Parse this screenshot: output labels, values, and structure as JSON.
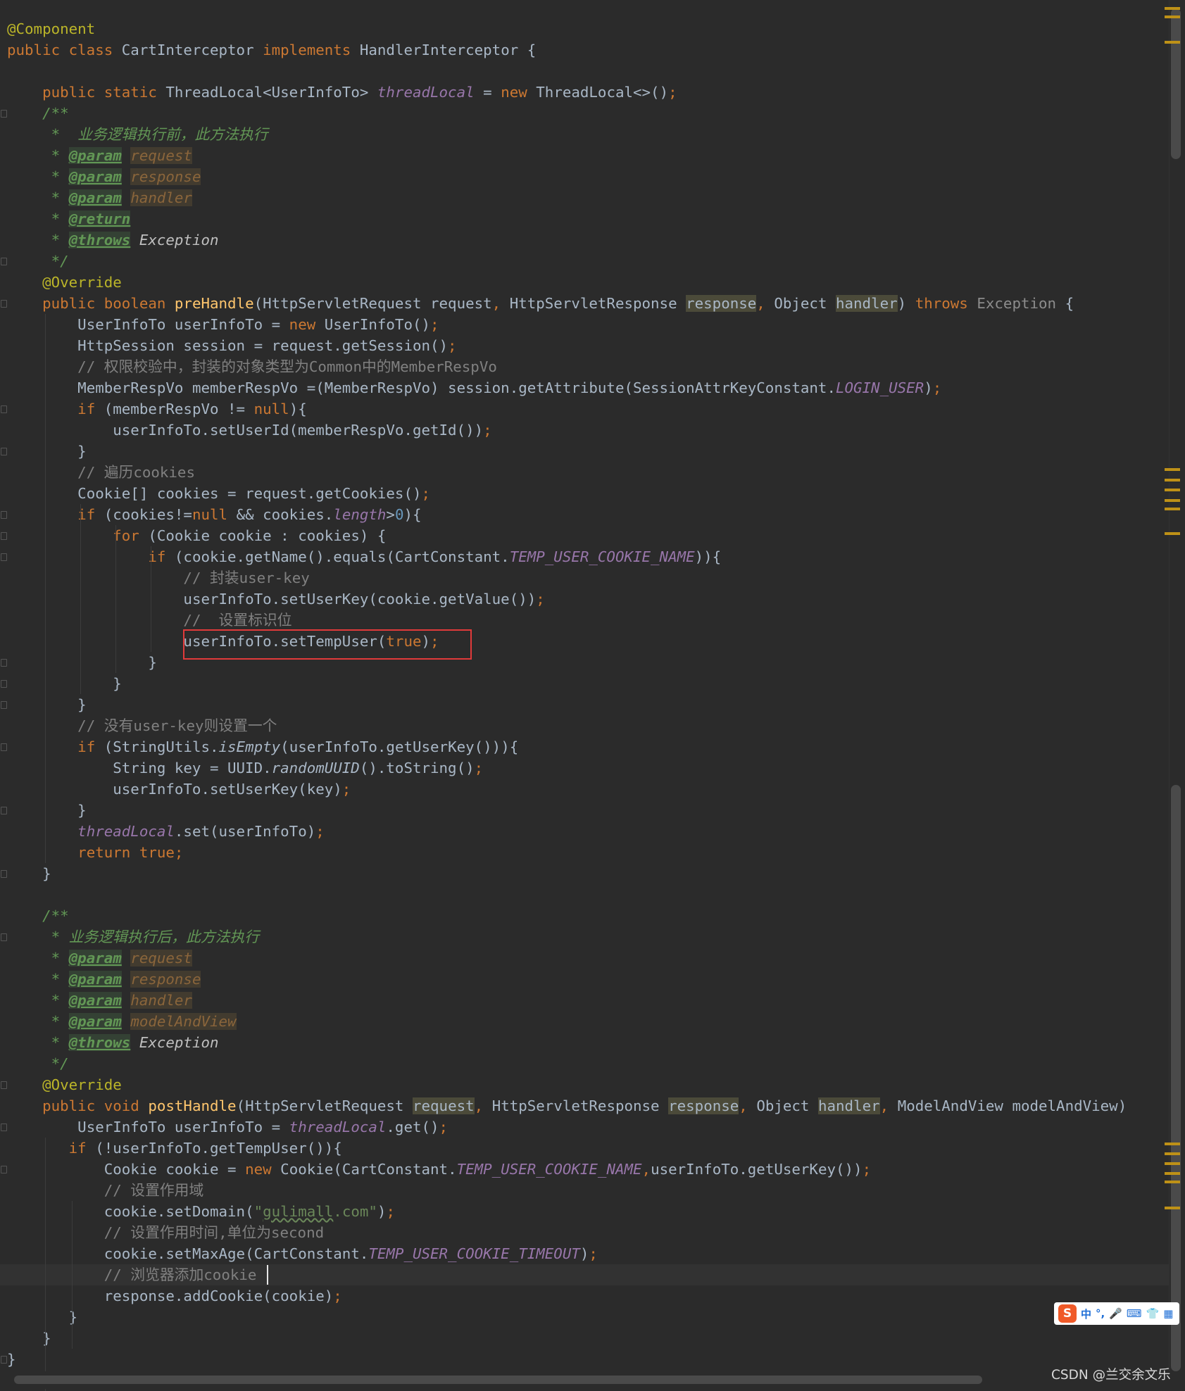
{
  "editor": {
    "code_lines": [
      {
        "indent": 0,
        "tokens": [
          {
            "t": "@Component",
            "c": "ann"
          }
        ]
      },
      {
        "indent": 0,
        "tokens": [
          {
            "t": "public class ",
            "c": "kw"
          },
          {
            "t": "CartInterceptor ",
            "c": "text"
          },
          {
            "t": "implements ",
            "c": "kw"
          },
          {
            "t": "HandlerInterceptor {",
            "c": "text"
          }
        ]
      },
      {
        "indent": 0,
        "tokens": []
      },
      {
        "indent": 4,
        "tokens": [
          {
            "t": "public static ",
            "c": "kw"
          },
          {
            "t": "ThreadLocal<UserInfoTo> ",
            "c": "text"
          },
          {
            "t": "threadLocal",
            "c": "field"
          },
          {
            "t": " = ",
            "c": "text"
          },
          {
            "t": "new ",
            "c": "kw"
          },
          {
            "t": "ThreadLocal<>()",
            "c": "text"
          },
          {
            "t": ";",
            "c": "semi"
          }
        ]
      },
      {
        "indent": 4,
        "tokens": [
          {
            "t": "/**",
            "c": "doc"
          }
        ]
      },
      {
        "indent": 4,
        "tokens": [
          {
            "t": " *  业务逻辑执行前，此方法执行",
            "c": "doc"
          }
        ]
      },
      {
        "indent": 4,
        "tokens": [
          {
            "t": " * ",
            "c": "doc"
          },
          {
            "t": "@param",
            "c": "tag"
          },
          {
            "t": " ",
            "c": "doc"
          },
          {
            "t": "request",
            "c": "tagval"
          }
        ]
      },
      {
        "indent": 4,
        "tokens": [
          {
            "t": " * ",
            "c": "doc"
          },
          {
            "t": "@param",
            "c": "tag"
          },
          {
            "t": " ",
            "c": "doc"
          },
          {
            "t": "response",
            "c": "tagval"
          }
        ]
      },
      {
        "indent": 4,
        "tokens": [
          {
            "t": " * ",
            "c": "doc"
          },
          {
            "t": "@param",
            "c": "tag"
          },
          {
            "t": " ",
            "c": "doc"
          },
          {
            "t": "handler",
            "c": "tagval"
          }
        ]
      },
      {
        "indent": 4,
        "tokens": [
          {
            "t": " * ",
            "c": "doc"
          },
          {
            "t": "@return",
            "c": "tag"
          }
        ]
      },
      {
        "indent": 4,
        "tokens": [
          {
            "t": " * ",
            "c": "doc"
          },
          {
            "t": "@throws",
            "c": "tag"
          },
          {
            "t": " Exception",
            "c": "docplain"
          }
        ]
      },
      {
        "indent": 4,
        "tokens": [
          {
            "t": " */",
            "c": "doc"
          }
        ]
      },
      {
        "indent": 4,
        "tokens": [
          {
            "t": "@Override",
            "c": "ann"
          }
        ]
      },
      {
        "indent": 4,
        "tokens": [
          {
            "t": "public boolean ",
            "c": "kw"
          },
          {
            "t": "preHandle",
            "c": "method"
          },
          {
            "t": "(HttpServletRequest request",
            "c": "text"
          },
          {
            "t": ", ",
            "c": "semi"
          },
          {
            "t": "HttpServletResponse ",
            "c": "text"
          },
          {
            "t": "response",
            "c": "hl"
          },
          {
            "t": ", ",
            "c": "semi"
          },
          {
            "t": "Object ",
            "c": "text"
          },
          {
            "t": "handler",
            "c": "hl"
          },
          {
            "t": ") ",
            "c": "text"
          },
          {
            "t": "throws ",
            "c": "kw"
          },
          {
            "t": "Exception",
            "c": "unused"
          },
          {
            "t": " {",
            "c": "text"
          }
        ]
      },
      {
        "indent": 8,
        "tokens": [
          {
            "t": "UserInfoTo userInfoTo = ",
            "c": "text"
          },
          {
            "t": "new ",
            "c": "kw"
          },
          {
            "t": "UserInfoTo()",
            "c": "text"
          },
          {
            "t": ";",
            "c": "semi"
          }
        ]
      },
      {
        "indent": 8,
        "tokens": [
          {
            "t": "HttpSession session = request.getSession()",
            "c": "text"
          },
          {
            "t": ";",
            "c": "semi"
          }
        ]
      },
      {
        "indent": 8,
        "tokens": [
          {
            "t": "// 权限校验中，封装的对象类型为Common中的MemberRespVo",
            "c": "comment"
          }
        ]
      },
      {
        "indent": 8,
        "tokens": [
          {
            "t": "MemberRespVo memberRespVo =(MemberRespVo) session.getAttribute(SessionAttrKeyConstant.",
            "c": "text"
          },
          {
            "t": "LOGIN_USER",
            "c": "field"
          },
          {
            "t": ")",
            "c": "text"
          },
          {
            "t": ";",
            "c": "semi"
          }
        ]
      },
      {
        "indent": 8,
        "tokens": [
          {
            "t": "if ",
            "c": "kw"
          },
          {
            "t": "(memberRespVo != ",
            "c": "text"
          },
          {
            "t": "null",
            "c": "kw"
          },
          {
            "t": "){",
            "c": "text"
          }
        ]
      },
      {
        "indent": 12,
        "tokens": [
          {
            "t": "userInfoTo.setUserId(memberRespVo.getId())",
            "c": "text"
          },
          {
            "t": ";",
            "c": "semi"
          }
        ]
      },
      {
        "indent": 8,
        "tokens": [
          {
            "t": "}",
            "c": "text"
          }
        ]
      },
      {
        "indent": 8,
        "tokens": [
          {
            "t": "// 遍历cookies",
            "c": "comment"
          }
        ]
      },
      {
        "indent": 8,
        "tokens": [
          {
            "t": "Cookie[] cookies = request.getCookies()",
            "c": "text"
          },
          {
            "t": ";",
            "c": "semi"
          }
        ]
      },
      {
        "indent": 8,
        "tokens": [
          {
            "t": "if ",
            "c": "kw"
          },
          {
            "t": "(cookies!=",
            "c": "text"
          },
          {
            "t": "null ",
            "c": "kw"
          },
          {
            "t": "&& cookies.",
            "c": "text"
          },
          {
            "t": "length",
            "c": "field"
          },
          {
            "t": ">",
            "c": "text"
          },
          {
            "t": "0",
            "c": "num"
          },
          {
            "t": "){",
            "c": "text"
          }
        ]
      },
      {
        "indent": 12,
        "tokens": [
          {
            "t": "for ",
            "c": "kw"
          },
          {
            "t": "(Cookie cookie : cookies) {",
            "c": "text"
          }
        ]
      },
      {
        "indent": 16,
        "tokens": [
          {
            "t": "if ",
            "c": "kw"
          },
          {
            "t": "(cookie.getName().equals(CartConstant.",
            "c": "text"
          },
          {
            "t": "TEMP_USER_COOKIE_NAME",
            "c": "field"
          },
          {
            "t": ")){",
            "c": "text"
          }
        ]
      },
      {
        "indent": 20,
        "tokens": [
          {
            "t": "// 封装user-key",
            "c": "comment"
          }
        ]
      },
      {
        "indent": 20,
        "tokens": [
          {
            "t": "userInfoTo.setUserKey(cookie.getValue())",
            "c": "text"
          },
          {
            "t": ";",
            "c": "semi"
          }
        ]
      },
      {
        "indent": 20,
        "tokens": [
          {
            "t": "//  设置标识位",
            "c": "comment"
          }
        ]
      },
      {
        "indent": 20,
        "tokens": [
          {
            "t": "userInfoTo.setTempUser(",
            "c": "text"
          },
          {
            "t": "true",
            "c": "kw"
          },
          {
            "t": ")",
            "c": "text"
          },
          {
            "t": ";",
            "c": "semi"
          }
        ]
      },
      {
        "indent": 16,
        "tokens": [
          {
            "t": "}",
            "c": "text"
          }
        ]
      },
      {
        "indent": 12,
        "tokens": [
          {
            "t": "}",
            "c": "text"
          }
        ]
      },
      {
        "indent": 8,
        "tokens": [
          {
            "t": "}",
            "c": "text"
          }
        ]
      },
      {
        "indent": 8,
        "tokens": [
          {
            "t": "// 没有user-key则设置一个",
            "c": "comment"
          }
        ]
      },
      {
        "indent": 8,
        "tokens": [
          {
            "t": "if ",
            "c": "kw"
          },
          {
            "t": "(StringUtils.",
            "c": "text"
          },
          {
            "t": "isEmpty",
            "c": "smethod"
          },
          {
            "t": "(userInfoTo.getUserKey())){",
            "c": "text"
          }
        ]
      },
      {
        "indent": 12,
        "tokens": [
          {
            "t": "String key = UUID.",
            "c": "text"
          },
          {
            "t": "randomUUID",
            "c": "smethod"
          },
          {
            "t": "().toString()",
            "c": "text"
          },
          {
            "t": ";",
            "c": "semi"
          }
        ]
      },
      {
        "indent": 12,
        "tokens": [
          {
            "t": "userInfoTo.setUserKey(key)",
            "c": "text"
          },
          {
            "t": ";",
            "c": "semi"
          }
        ]
      },
      {
        "indent": 8,
        "tokens": [
          {
            "t": "}",
            "c": "text"
          }
        ]
      },
      {
        "indent": 8,
        "tokens": [
          {
            "t": "threadLocal",
            "c": "field"
          },
          {
            "t": ".set(userInfoTo)",
            "c": "text"
          },
          {
            "t": ";",
            "c": "semi"
          }
        ]
      },
      {
        "indent": 8,
        "tokens": [
          {
            "t": "return true",
            "c": "kw"
          },
          {
            "t": ";",
            "c": "semi"
          }
        ]
      },
      {
        "indent": 4,
        "tokens": [
          {
            "t": "}",
            "c": "text"
          }
        ]
      },
      {
        "indent": 0,
        "tokens": []
      },
      {
        "indent": 4,
        "tokens": [
          {
            "t": "/**",
            "c": "doc"
          }
        ]
      },
      {
        "indent": 4,
        "tokens": [
          {
            "t": " * 业务逻辑执行后，此方法执行",
            "c": "doc"
          }
        ]
      },
      {
        "indent": 4,
        "tokens": [
          {
            "t": " * ",
            "c": "doc"
          },
          {
            "t": "@param",
            "c": "tag"
          },
          {
            "t": " ",
            "c": "doc"
          },
          {
            "t": "request",
            "c": "tagval"
          }
        ]
      },
      {
        "indent": 4,
        "tokens": [
          {
            "t": " * ",
            "c": "doc"
          },
          {
            "t": "@param",
            "c": "tag"
          },
          {
            "t": " ",
            "c": "doc"
          },
          {
            "t": "response",
            "c": "tagval"
          }
        ]
      },
      {
        "indent": 4,
        "tokens": [
          {
            "t": " * ",
            "c": "doc"
          },
          {
            "t": "@param",
            "c": "tag"
          },
          {
            "t": " ",
            "c": "doc"
          },
          {
            "t": "handler",
            "c": "tagval"
          }
        ]
      },
      {
        "indent": 4,
        "tokens": [
          {
            "t": " * ",
            "c": "doc"
          },
          {
            "t": "@param",
            "c": "tag"
          },
          {
            "t": " ",
            "c": "doc"
          },
          {
            "t": "modelAndView",
            "c": "tagval"
          }
        ]
      },
      {
        "indent": 4,
        "tokens": [
          {
            "t": " * ",
            "c": "doc"
          },
          {
            "t": "@throws",
            "c": "tag"
          },
          {
            "t": " Exception",
            "c": "docplain"
          }
        ]
      },
      {
        "indent": 4,
        "tokens": [
          {
            "t": " */",
            "c": "doc"
          }
        ]
      },
      {
        "indent": 4,
        "tokens": [
          {
            "t": "@Override",
            "c": "ann"
          }
        ]
      },
      {
        "indent": 4,
        "tokens": [
          {
            "t": "public void ",
            "c": "kw"
          },
          {
            "t": "postHandle",
            "c": "method"
          },
          {
            "t": "(HttpServletRequest ",
            "c": "text"
          },
          {
            "t": "request",
            "c": "hl"
          },
          {
            "t": ", ",
            "c": "semi"
          },
          {
            "t": "HttpServletResponse ",
            "c": "text"
          },
          {
            "t": "response",
            "c": "hl"
          },
          {
            "t": ", ",
            "c": "semi"
          },
          {
            "t": "Object ",
            "c": "text"
          },
          {
            "t": "handler",
            "c": "hl"
          },
          {
            "t": ", ",
            "c": "semi"
          },
          {
            "t": "ModelAndView modelAndView)",
            "c": "text"
          }
        ]
      },
      {
        "indent": 8,
        "tokens": [
          {
            "t": "UserInfoTo userInfoTo = ",
            "c": "text"
          },
          {
            "t": "threadLocal",
            "c": "field"
          },
          {
            "t": ".get()",
            "c": "text"
          },
          {
            "t": ";",
            "c": "semi"
          }
        ]
      },
      {
        "indent": 7,
        "tokens": [
          {
            "t": "if ",
            "c": "kw"
          },
          {
            "t": "(!userInfoTo.getTempUser()){",
            "c": "text"
          }
        ]
      },
      {
        "indent": 11,
        "tokens": [
          {
            "t": "Cookie cookie = ",
            "c": "text"
          },
          {
            "t": "new ",
            "c": "kw"
          },
          {
            "t": "Cookie(CartConstant.",
            "c": "text"
          },
          {
            "t": "TEMP_USER_COOKIE_NAME",
            "c": "field"
          },
          {
            "t": ",",
            "c": "semi"
          },
          {
            "t": "userInfoTo.getUserKey())",
            "c": "text"
          },
          {
            "t": ";",
            "c": "semi"
          }
        ]
      },
      {
        "indent": 11,
        "tokens": [
          {
            "t": "// 设置作用域",
            "c": "comment"
          }
        ]
      },
      {
        "indent": 11,
        "tokens": [
          {
            "t": "cookie.setDomain(",
            "c": "text"
          },
          {
            "t": "\"",
            "c": "string"
          },
          {
            "t": "gulimall",
            "c": "typo"
          },
          {
            "t": ".com\"",
            "c": "string"
          },
          {
            "t": ")",
            "c": "text"
          },
          {
            "t": ";",
            "c": "semi"
          }
        ]
      },
      {
        "indent": 11,
        "tokens": [
          {
            "t": "// 设置作用时间,单位为second",
            "c": "comment"
          }
        ]
      },
      {
        "indent": 11,
        "tokens": [
          {
            "t": "cookie.setMaxAge(CartConstant.",
            "c": "text"
          },
          {
            "t": "TEMP_USER_COOKIE_TIMEOUT",
            "c": "field"
          },
          {
            "t": ")",
            "c": "text"
          },
          {
            "t": ";",
            "c": "semi"
          }
        ]
      },
      {
        "indent": 11,
        "current": true,
        "tokens": [
          {
            "t": "// 浏览器添加cookie",
            "c": "comment"
          }
        ]
      },
      {
        "indent": 11,
        "tokens": [
          {
            "t": "response.addCookie(cookie)",
            "c": "text"
          },
          {
            "t": ";",
            "c": "semi"
          }
        ]
      },
      {
        "indent": 7,
        "tokens": [
          {
            "t": "}",
            "c": "text"
          }
        ]
      },
      {
        "indent": 4,
        "tokens": [
          {
            "t": "}",
            "c": "text"
          }
        ]
      },
      {
        "indent": 0,
        "tokens": [
          {
            "t": "}",
            "c": "text"
          }
        ]
      }
    ]
  },
  "ime_toolbar": {
    "logo": "S",
    "items": [
      "中",
      "°,",
      "🎤",
      "⌨",
      "👕",
      "▦"
    ]
  },
  "watermark": "CSDN @兰交余文乐",
  "colors": {
    "background": "#2b2b2b",
    "keyword": "#cc7832",
    "annotation": "#bbb529",
    "method_declaration": "#ffc66d",
    "field": "#9876aa",
    "comment": "#808080",
    "javadoc": "#629755",
    "number": "#6897bb",
    "string": "#6a8759",
    "highlight_box": "#e03a3a"
  }
}
